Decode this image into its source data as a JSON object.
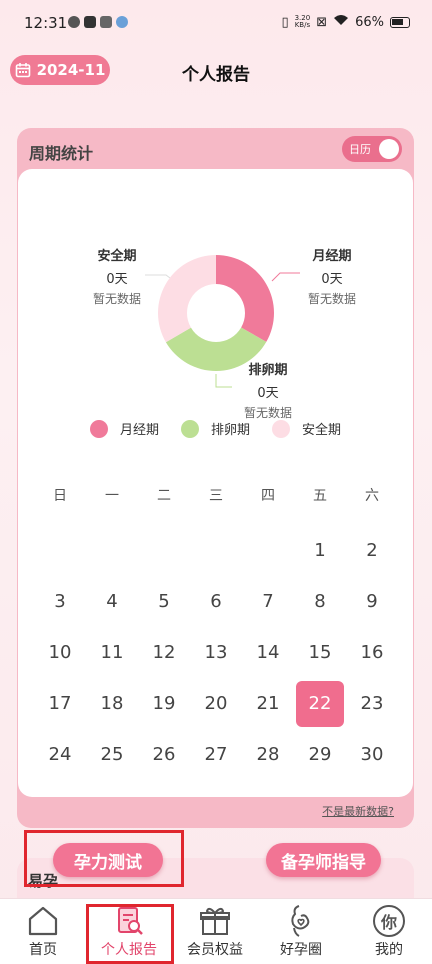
{
  "status_bar": {
    "time": "12:31",
    "speed_value": "3.20",
    "speed_unit": "KB/s",
    "battery": "66%"
  },
  "header": {
    "date": "2024-11",
    "title": "个人报告"
  },
  "cycle": {
    "title": "周期统计",
    "toggle_label": "日历",
    "stats": {
      "menstrual": {
        "name": "月经期",
        "days": "0天",
        "nodata": "暂无数据"
      },
      "ovulation": {
        "name": "排卵期",
        "days": "0天",
        "nodata": "暂无数据"
      },
      "safe": {
        "name": "安全期",
        "days": "0天",
        "nodata": "暂无数据"
      }
    },
    "legend": [
      {
        "label": "月经期",
        "color": "#f07a9a"
      },
      {
        "label": "排卵期",
        "color": "#bcdf93"
      },
      {
        "label": "安全期",
        "color": "#fddde4"
      }
    ],
    "donut_fractions": {
      "menstrual": 0.333,
      "ovulation": 0.333,
      "safe": 0.334
    },
    "weekdays": [
      "日",
      "一",
      "二",
      "三",
      "四",
      "五",
      "六"
    ],
    "days": [
      "",
      "",
      "",
      "",
      "",
      "1",
      "2",
      "3",
      "4",
      "5",
      "6",
      "7",
      "8",
      "9",
      "10",
      "11",
      "12",
      "13",
      "14",
      "15",
      "16",
      "17",
      "18",
      "19",
      "20",
      "21",
      "22",
      "23",
      "24",
      "25",
      "26",
      "27",
      "28",
      "29",
      "30"
    ],
    "today": "22",
    "not_latest": "不是最新数据?"
  },
  "buttons": {
    "fertility_test": "孕力测试",
    "coach_guide": "备孕师指导"
  },
  "peek": {
    "title": "易孕"
  },
  "tabs": [
    {
      "label": "首页",
      "icon": "home-icon"
    },
    {
      "label": "个人报告",
      "icon": "report-icon"
    },
    {
      "label": "会员权益",
      "icon": "gift-icon"
    },
    {
      "label": "好孕圈",
      "icon": "pregnancy-icon"
    },
    {
      "label": "我的",
      "icon": "me-icon",
      "icon_text": "你"
    }
  ]
}
